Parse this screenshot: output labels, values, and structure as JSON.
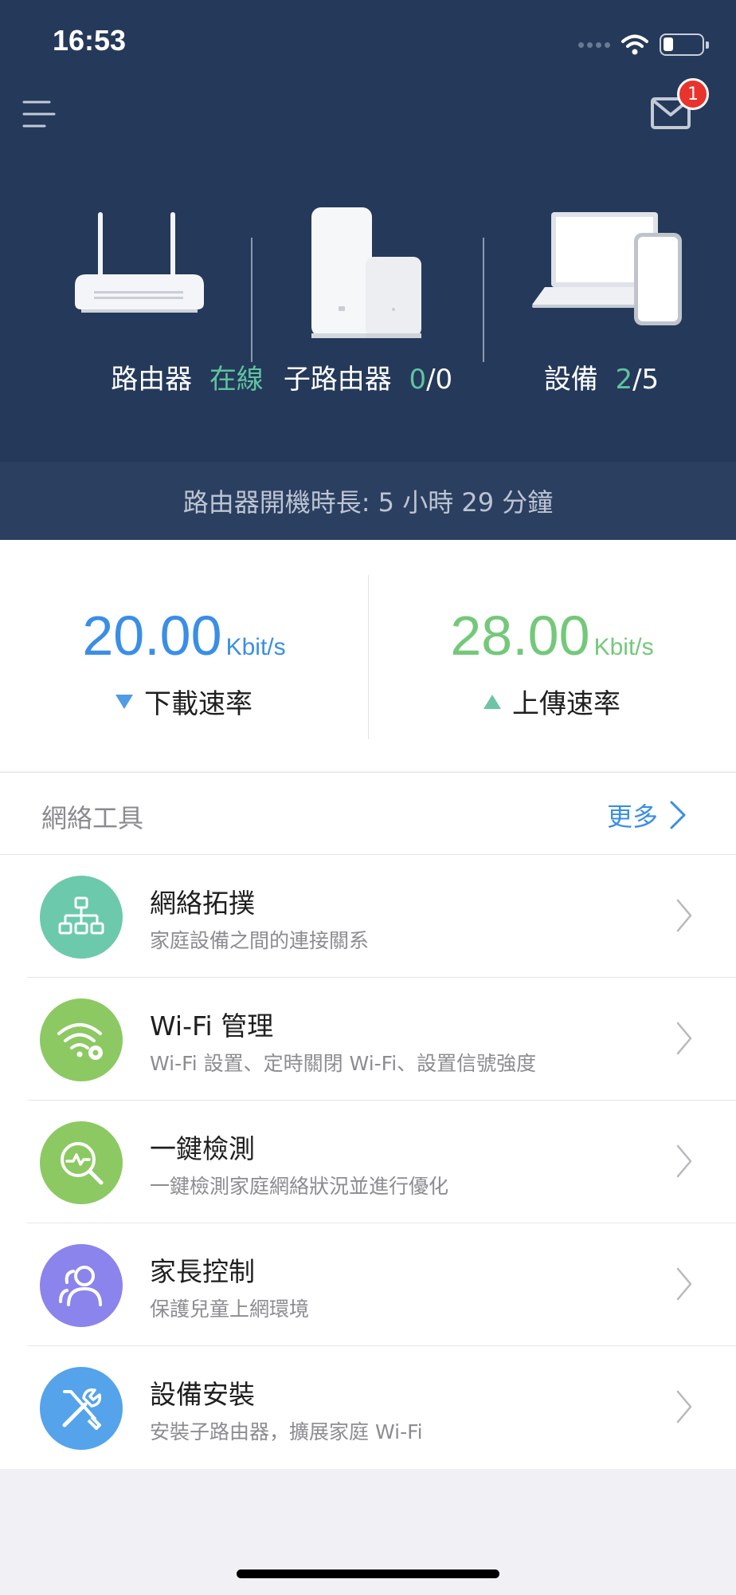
{
  "status_bar": {
    "time": "16:53"
  },
  "mail": {
    "badge_count": "1"
  },
  "devices": {
    "router": {
      "label": "路由器",
      "status": "在線"
    },
    "subrouter": {
      "label": "子路由器",
      "online": "0",
      "total": "/0"
    },
    "device": {
      "label": "設備",
      "online": "2",
      "total": "/5"
    }
  },
  "uptime": "路由器開機時長: 5 小時 29 分鐘",
  "speed": {
    "download": {
      "value": "20.00",
      "unit": "Kbit/s",
      "label": "下載速率",
      "color": "#3a8ee6"
    },
    "upload": {
      "value": "28.00",
      "unit": "Kbit/s",
      "label": "上傳速率",
      "color": "#74c87a"
    }
  },
  "tools": {
    "title": "網絡工具",
    "more": "更多",
    "items": [
      {
        "title": "網絡拓撲",
        "subtitle": "家庭設備之間的連接關系",
        "icon": "topology-icon",
        "color": "#6cc9ac"
      },
      {
        "title": "Wi-Fi 管理",
        "subtitle": "Wi-Fi 設置、定時關閉 Wi-Fi、設置信號強度",
        "icon": "wifi-settings-icon",
        "color": "#8cc962"
      },
      {
        "title": "一鍵檢測",
        "subtitle": "一鍵檢測家庭網絡狀況並進行優化",
        "icon": "diagnose-icon",
        "color": "#8cc962"
      },
      {
        "title": "家長控制",
        "subtitle": "保護兒童上網環境",
        "icon": "parental-control-icon",
        "color": "#8b84ec"
      },
      {
        "title": "設備安裝",
        "subtitle": "安裝子路由器，擴展家庭 Wi-Fi",
        "icon": "tools-icon",
        "color": "#55a3ea"
      }
    ]
  }
}
